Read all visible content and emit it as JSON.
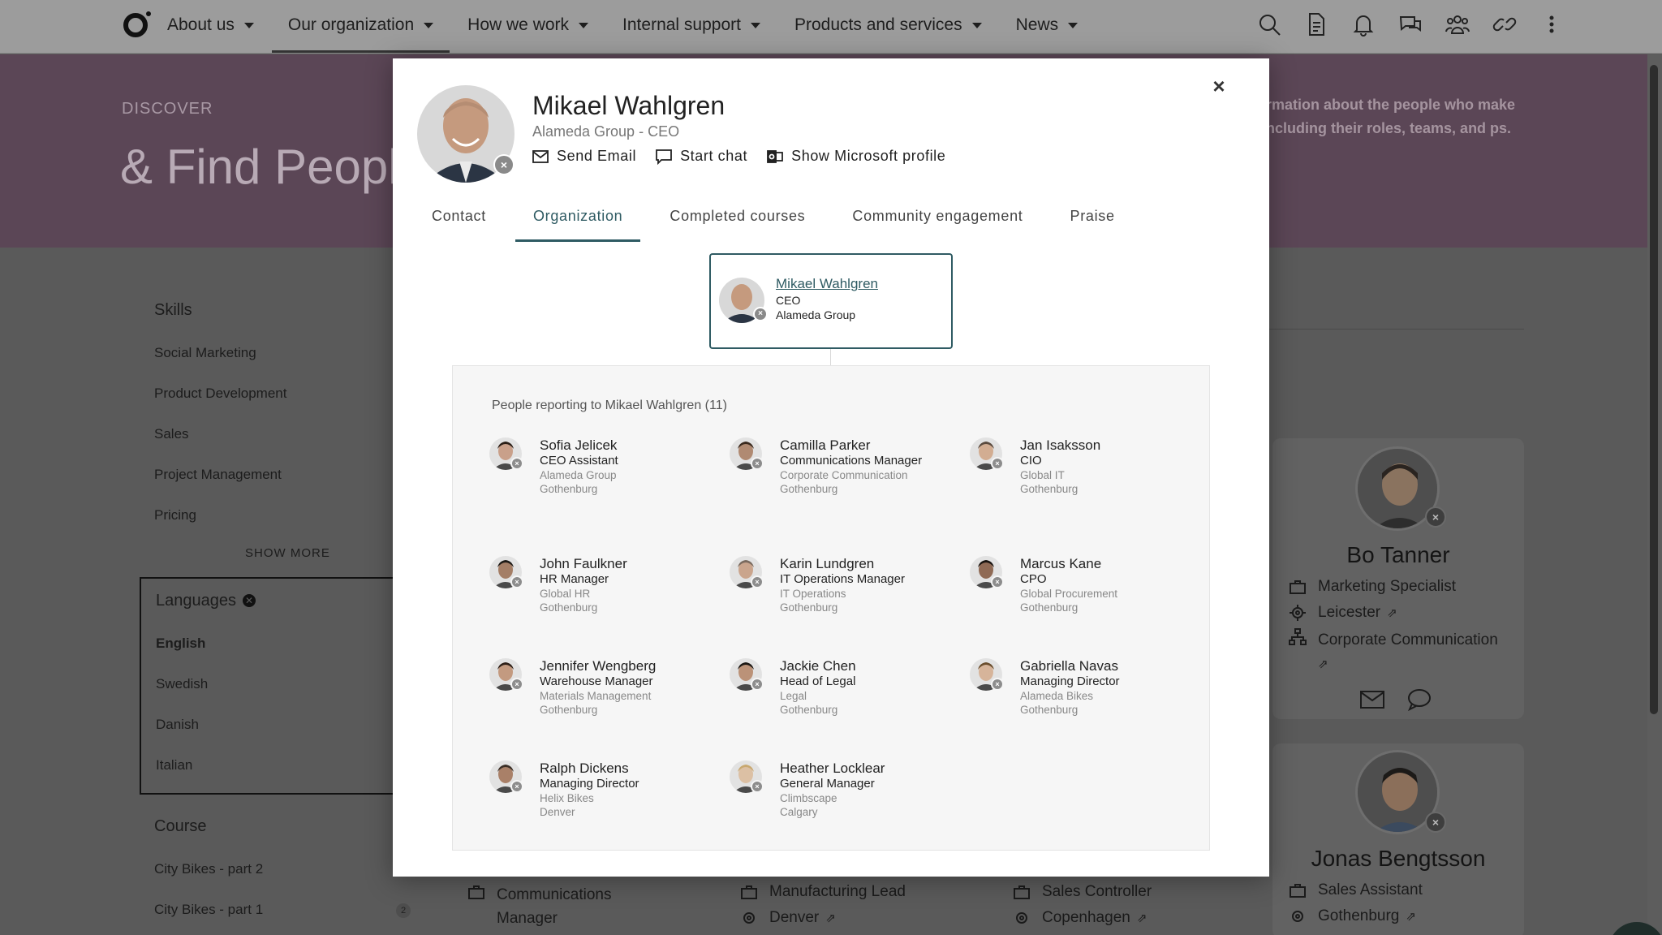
{
  "nav": {
    "items": [
      "About us",
      "Our organization",
      "How we work",
      "Internal support",
      "Products and services",
      "News"
    ],
    "active_index": 1
  },
  "hero": {
    "eyebrow": "DISCOVER",
    "title": "& Find People",
    "description": "rmation about the people who make ncluding their roles, teams, and ps."
  },
  "sidebar": {
    "skills_title": "Skills",
    "skills": [
      "Social Marketing",
      "Product Development",
      "Sales",
      "Project Management",
      "Pricing"
    ],
    "show_more": "SHOW MORE",
    "languages_title": "Languages",
    "languages": [
      "English",
      "Swedish",
      "Danish",
      "Italian"
    ],
    "selected_language": "English",
    "course_title": "Course",
    "courses": [
      "City Bikes - part 2",
      "City Bikes - part 1"
    ],
    "course_count": "2"
  },
  "background_cards": {
    "bo": {
      "name": "Bo Tanner",
      "role": "Marketing Specialist",
      "location": "Leicester",
      "department": "Corporate Communication"
    },
    "jonas": {
      "name": "Jonas Bengtsson",
      "role": "Sales Assistant",
      "location": "Gothenburg"
    },
    "bottom_row": [
      {
        "role": "Communications Manager",
        "location": ""
      },
      {
        "role": "Manufacturing Lead",
        "location": "Denver"
      },
      {
        "role": "Sales Controller",
        "location": "Copenhagen"
      }
    ]
  },
  "modal": {
    "name": "Mikael Wahlgren",
    "subtitle": "Alameda Group - CEO",
    "actions": {
      "email": "Send Email",
      "chat": "Start chat",
      "profile": "Show Microsoft profile"
    },
    "close": "×",
    "tabs": [
      "Contact",
      "Organization",
      "Completed courses",
      "Community engagement",
      "Praise"
    ],
    "active_tab": "Organization",
    "root": {
      "name": "Mikael Wahlgren",
      "title": "CEO",
      "org": "Alameda Group"
    },
    "reports_heading": "People reporting to Mikael Wahlgren (11)",
    "reports": [
      {
        "name": "Sofia Jelicek",
        "title": "CEO Assistant",
        "department": "Alameda Group",
        "location": "Gothenburg"
      },
      {
        "name": "Camilla Parker",
        "title": "Communications Manager",
        "department": "Corporate Communication",
        "location": "Gothenburg"
      },
      {
        "name": "Jan Isaksson",
        "title": "CIO",
        "department": "Global IT",
        "location": "Gothenburg"
      },
      {
        "name": "John Faulkner",
        "title": "HR Manager",
        "department": "Global HR",
        "location": "Gothenburg"
      },
      {
        "name": "Karin Lundgren",
        "title": "IT Operations Manager",
        "department": "IT Operations",
        "location": "Gothenburg"
      },
      {
        "name": "Marcus Kane",
        "title": "CPO",
        "department": "Global Procurement",
        "location": "Gothenburg"
      },
      {
        "name": "Jennifer Wengberg",
        "title": "Warehouse Manager",
        "department": "Materials Management",
        "location": "Gothenburg"
      },
      {
        "name": "Jackie Chen",
        "title": "Head of Legal",
        "department": "Legal",
        "location": "Gothenburg"
      },
      {
        "name": "Gabriella Navas",
        "title": "Managing Director",
        "department": "Alameda Bikes",
        "location": "Gothenburg"
      },
      {
        "name": "Ralph Dickens",
        "title": "Managing Director",
        "department": "Helix Bikes",
        "location": "Denver"
      },
      {
        "name": "Heather Locklear",
        "title": "General Manager",
        "department": "Climbscape",
        "location": "Calgary"
      }
    ]
  },
  "icons": [
    "search-icon",
    "document-icon",
    "bell-icon",
    "chat-icon",
    "people-icon",
    "link-icon",
    "more-icon"
  ],
  "colors": {
    "accent": "#2f5b63",
    "hero": "#5b4656",
    "overlay": "#5a5a5a"
  }
}
